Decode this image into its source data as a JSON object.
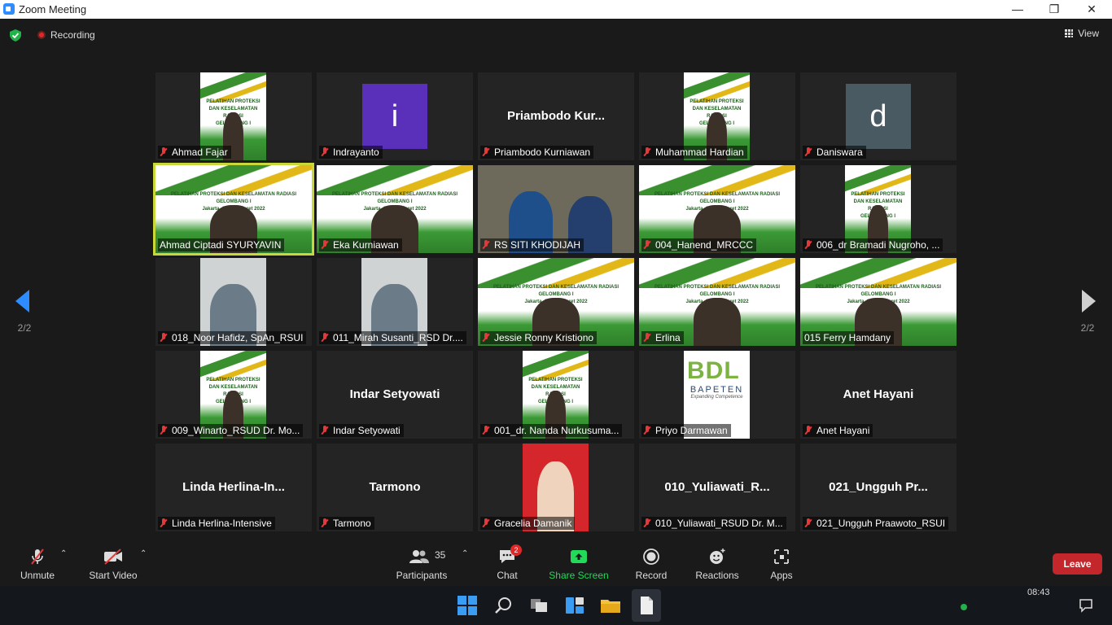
{
  "window": {
    "title": "Zoom Meeting",
    "minimize": "—",
    "restore": "❐",
    "close": "✕"
  },
  "topbar": {
    "recording_label": "Recording",
    "view_label": "View"
  },
  "pagination": {
    "left": "2/2",
    "right": "2/2"
  },
  "tiles": [
    {
      "name": "Ahmad Fajar",
      "type": "banner-narrow",
      "muted": true
    },
    {
      "name": "Indrayanto",
      "type": "initial",
      "initial": "i",
      "color": "#5a2fba",
      "muted": true
    },
    {
      "name": "Priambodo Kurniawan",
      "type": "text",
      "display": "Priambodo  Kur...",
      "muted": true
    },
    {
      "name": "Muhammad Hardian",
      "type": "banner-narrow",
      "muted": true
    },
    {
      "name": "Daniswara",
      "type": "initial",
      "initial": "d",
      "color": "#4a5a63",
      "muted": true
    },
    {
      "name": "Ahmad Ciptadi SYURYAVIN",
      "type": "banner-full",
      "muted": false,
      "active": true
    },
    {
      "name": "Eka Kurniawan",
      "type": "banner-full",
      "muted": true
    },
    {
      "name": "RS SITI KHODIJAH",
      "type": "room",
      "muted": true
    },
    {
      "name": "004_Hanend_MRCCC",
      "type": "banner-full",
      "muted": true
    },
    {
      "name": "006_dr Bramadi Nugroho, ...",
      "type": "banner-narrow",
      "muted": true
    },
    {
      "name": "018_Noor Hafidz, SpAn_RSUI",
      "type": "person-narrow",
      "muted": true
    },
    {
      "name": "011_Mirah Susanti_RSD Dr....",
      "type": "person-narrow",
      "muted": true
    },
    {
      "name": "Jessie Ronny Kristiono",
      "type": "banner-full",
      "muted": true
    },
    {
      "name": "Erlina",
      "type": "banner-full",
      "muted": true
    },
    {
      "name": "015 Ferry Hamdany",
      "type": "banner-full",
      "muted": false
    },
    {
      "name": "009_Winarto_RSUD Dr. Mo...",
      "type": "banner-narrow",
      "muted": true
    },
    {
      "name": "Indar Setyowati",
      "type": "text",
      "display": "Indar Setyowati",
      "muted": true
    },
    {
      "name": "001_dr. Nanda Nurkusuma...",
      "type": "banner-narrow",
      "muted": true
    },
    {
      "name": "Priyo Darmawan",
      "type": "logo",
      "muted": true
    },
    {
      "name": "Anet Hayani",
      "type": "text",
      "display": "Anet Hayani",
      "muted": true
    },
    {
      "name": "Linda Herlina-Intensive",
      "type": "text",
      "display": "Linda  Herlina-In...",
      "muted": true
    },
    {
      "name": "Tarmono",
      "type": "text",
      "display": "Tarmono",
      "muted": true
    },
    {
      "name": "Gracelia Damanik",
      "type": "photo",
      "muted": true
    },
    {
      "name": "010_Yuliawati_RSUD Dr. M...",
      "type": "text",
      "display": "010_Yuliawati_R...",
      "muted": true
    },
    {
      "name": "021_Ungguh Praawoto_RSUI",
      "type": "text",
      "display": "021_Ungguh  Pr...",
      "muted": true
    }
  ],
  "banner_text": {
    "line1": "PELATIHAN PROTEKSI DAN KESELAMATAN RADIASI",
    "line2": "GELOMBANG I",
    "line3": "Jakarta, 21 – 25 Maret 2022"
  },
  "logo_text": {
    "brand": "BAPETEN",
    "tagline": "Expanding Competence"
  },
  "toolbar": {
    "unmute": "Unmute",
    "start_video": "Start Video",
    "participants": "Participants",
    "participants_count": "35",
    "chat": "Chat",
    "chat_badge": "2",
    "share_screen": "Share Screen",
    "record": "Record",
    "reactions": "Reactions",
    "apps": "Apps",
    "leave": "Leave"
  },
  "taskbar": {
    "clock": "08:43"
  },
  "colors": {
    "accent": "#2d8cff",
    "leave": "#c3272b",
    "share": "#23d959",
    "active_border": "#c8d83a"
  }
}
